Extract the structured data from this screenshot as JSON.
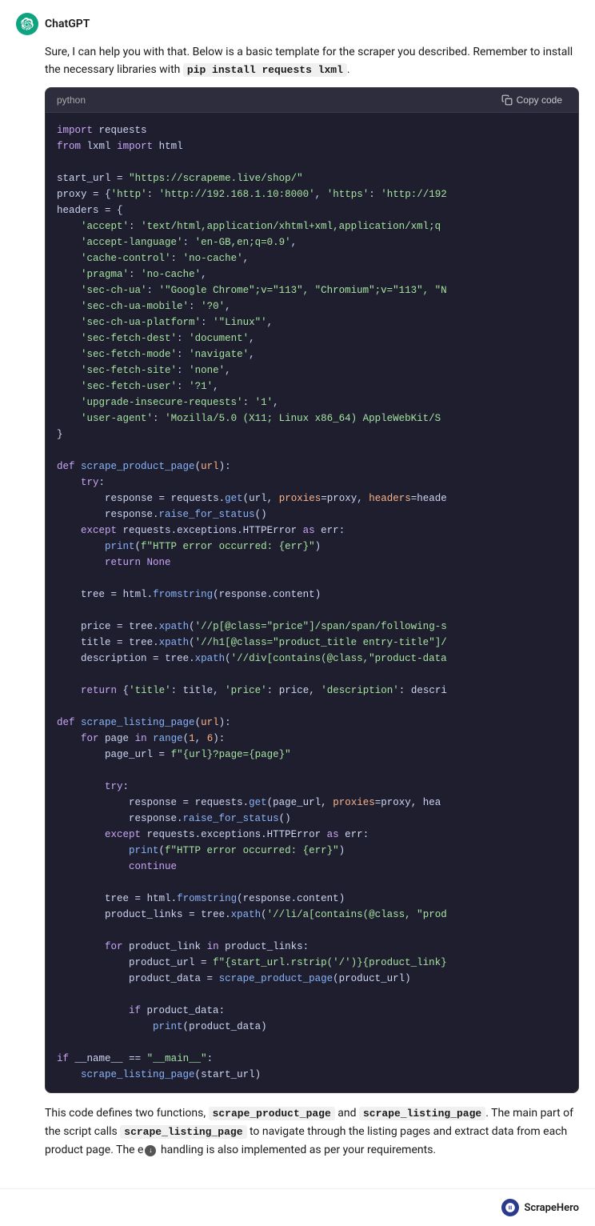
{
  "assistant": {
    "name": "ChatGPT",
    "avatar_label": "chatgpt-logo",
    "intro_text": "Sure, I can help you with that. Below is a basic template for the scraper you described. Remember to install the necessary libraries with ",
    "install_cmd": "pip install requests lxml",
    "install_cmd_suffix": ".",
    "code_block": {
      "language": "python",
      "copy_label": "Copy code"
    },
    "description": {
      "part1": "This code defines two functions, ",
      "fn1": "scrape_product_page",
      "part2": " and ",
      "fn2": "scrape_listing_page",
      "part3": ". The main part of the script calls ",
      "fn3": "scrape_listing_page",
      "part4": " to navigate through the listing pages and extract data from each product page. The e",
      "down_arrow": "↓",
      "part5": " handling is also implemented as per your requirements."
    }
  },
  "footer": {
    "logo_text": "ScrapeHero"
  }
}
